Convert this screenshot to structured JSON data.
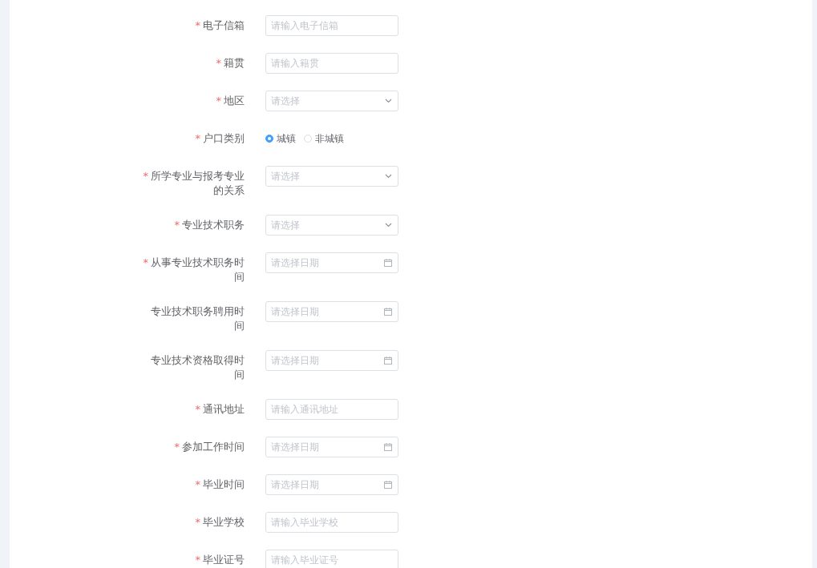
{
  "form": {
    "fields": [
      {
        "kind": "text",
        "required_mark": "*",
        "label": "电子信箱",
        "placeholder": "请输入电子信箱"
      },
      {
        "kind": "text",
        "required_mark": "*",
        "label": "籍贯",
        "placeholder": "请输入籍贯"
      },
      {
        "kind": "select",
        "required_mark": "*",
        "label": "地区",
        "placeholder": "请选择"
      },
      {
        "kind": "radio",
        "required_mark": "*",
        "label": "户口类别",
        "options": [
          {
            "label": "城镇",
            "selected": true
          },
          {
            "label": "非城镇",
            "selected": false
          }
        ]
      },
      {
        "kind": "select",
        "required_mark": "*",
        "label": "所学专业与报考专业的关系",
        "placeholder": "请选择"
      },
      {
        "kind": "select",
        "required_mark": "*",
        "label": "专业技术职务",
        "placeholder": "请选择"
      },
      {
        "kind": "date",
        "required_mark": "*",
        "label": "从事专业技术职务时间",
        "placeholder": "请选择日期"
      },
      {
        "kind": "date",
        "label": "专业技术职务聘用时间",
        "placeholder": "请选择日期"
      },
      {
        "kind": "date",
        "label": "专业技术资格取得时间",
        "placeholder": "请选择日期"
      },
      {
        "kind": "text",
        "required_mark": "*",
        "label": "通讯地址",
        "placeholder": "请输入通讯地址"
      },
      {
        "kind": "date",
        "required_mark": "*",
        "label": "参加工作时间",
        "placeholder": "请选择日期"
      },
      {
        "kind": "date",
        "required_mark": "*",
        "label": "毕业时间",
        "placeholder": "请选择日期"
      },
      {
        "kind": "text",
        "required_mark": "*",
        "label": "毕业学校",
        "placeholder": "请输入毕业学校"
      },
      {
        "kind": "text",
        "required_mark": "*",
        "label": "毕业证号",
        "placeholder": "请输入毕业证号"
      }
    ]
  }
}
